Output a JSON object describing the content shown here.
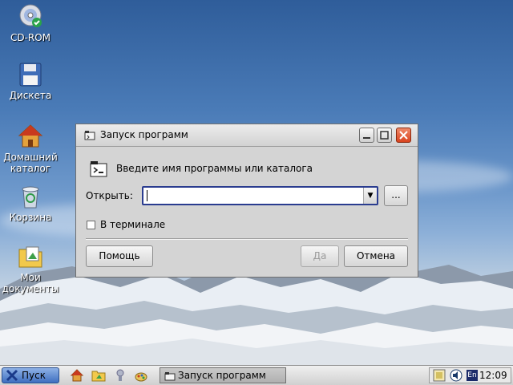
{
  "desktop": {
    "icons": [
      {
        "label": "CD-ROM",
        "icon": "cdrom-icon"
      },
      {
        "label": "Дискета",
        "icon": "floppy-icon"
      },
      {
        "label": "Домашний каталог",
        "icon": "home-folder-icon"
      },
      {
        "label": "Корзина",
        "icon": "trash-icon"
      },
      {
        "label": "Мои документы",
        "icon": "documents-icon"
      }
    ]
  },
  "dialog": {
    "title": "Запуск программ",
    "prompt": "Введите имя программы или каталога",
    "open_label": "Открыть:",
    "open_value": "",
    "browse_label": "...",
    "terminal_label": "В терминале",
    "terminal_checked": false,
    "help_label": "Помощь",
    "yes_label": "Да",
    "cancel_label": "Отмена"
  },
  "taskbar": {
    "start_label": "Пуск",
    "quicklaunch": [
      "home-icon",
      "folder-icon",
      "hint-icon",
      "paint-icon"
    ],
    "task_label": "Запуск программ",
    "lang": "En",
    "clock": "12:09"
  }
}
